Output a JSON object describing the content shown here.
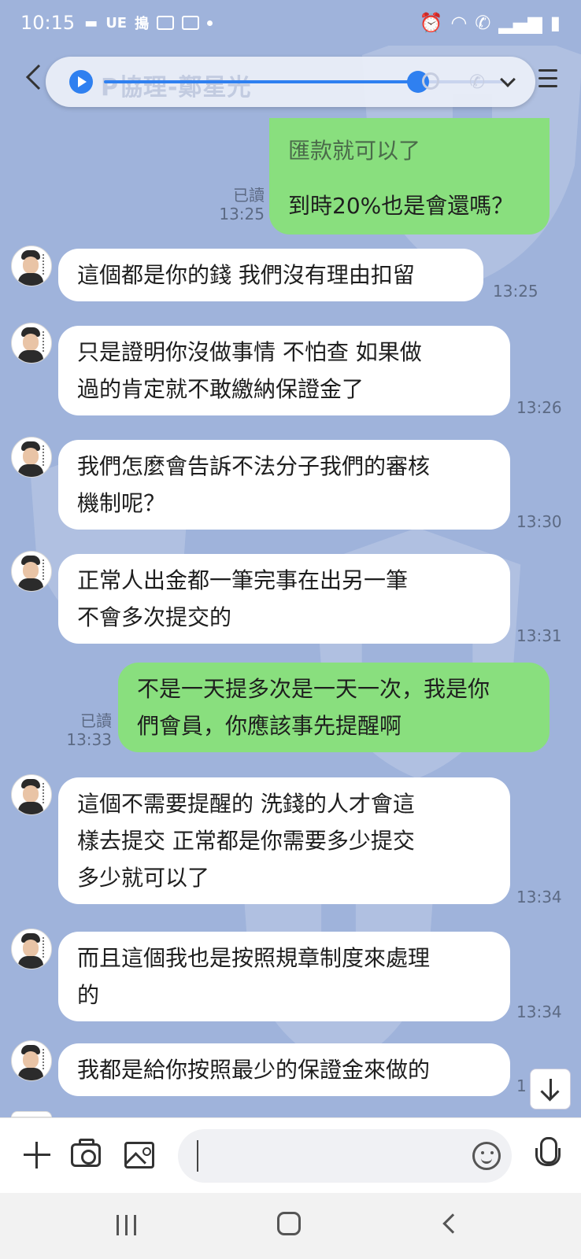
{
  "status_bar": {
    "time": "10:15",
    "left_icons": [
      "chat-notification-icon",
      "ue-icon",
      "app-icon",
      "gallery-icon",
      "screen-icon"
    ],
    "right_icons": [
      "alarm-icon",
      "wifi-icon",
      "wifi-calling-icon",
      "signal-icon",
      "battery-icon"
    ]
  },
  "header": {
    "title": "P協理-鄭星光",
    "player": {
      "progress": 0.78
    }
  },
  "messages": [
    {
      "side": "me",
      "read": "",
      "time": "",
      "text": "匯款就可以了",
      "partial": true
    },
    {
      "side": "me",
      "read": "已讀",
      "time": "13:25",
      "text": "到時20%也是會還嗎？"
    },
    {
      "side": "them",
      "time": "13:25",
      "lines": [
        "這個都是你的錢 我們沒有理由扣留"
      ]
    },
    {
      "side": "them",
      "time": "13:26",
      "lines": [
        "只是證明你沒做事情 不怕查  如果做",
        "過的肯定就不敢繳納保證金了"
      ]
    },
    {
      "side": "them",
      "time": "13:30",
      "lines": [
        "我們怎麼會告訴不法分子我們的審核",
        "機制呢？"
      ]
    },
    {
      "side": "them",
      "time": "13:31",
      "lines": [
        "正常人出金都一筆完事在出另一筆",
        "不會多次提交的"
      ]
    },
    {
      "side": "me",
      "read": "已讀",
      "time": "13:33",
      "lines": [
        "不是一天提多次是一天一次，我是你",
        "們會員，你應該事先提醒啊"
      ]
    },
    {
      "side": "them",
      "time": "13:34",
      "lines": [
        "這個不需要提醒的  洗錢的人才會這",
        "樣去提交 正常都是你需要多少提交",
        "多少就可以了"
      ]
    },
    {
      "side": "them",
      "time": "13:34",
      "lines": [
        "而且這個我也是按照規章制度來處理",
        "的"
      ]
    },
    {
      "side": "them",
      "time": "1",
      "lines": [
        "我都是給你按照最少的保證金來做的"
      ]
    }
  ],
  "input": {
    "placeholder": ""
  },
  "colors": {
    "background": "#9fb3db",
    "my_bubble": "#89df7e",
    "their_bubble": "#ffffff",
    "accent": "#2f80f0"
  }
}
